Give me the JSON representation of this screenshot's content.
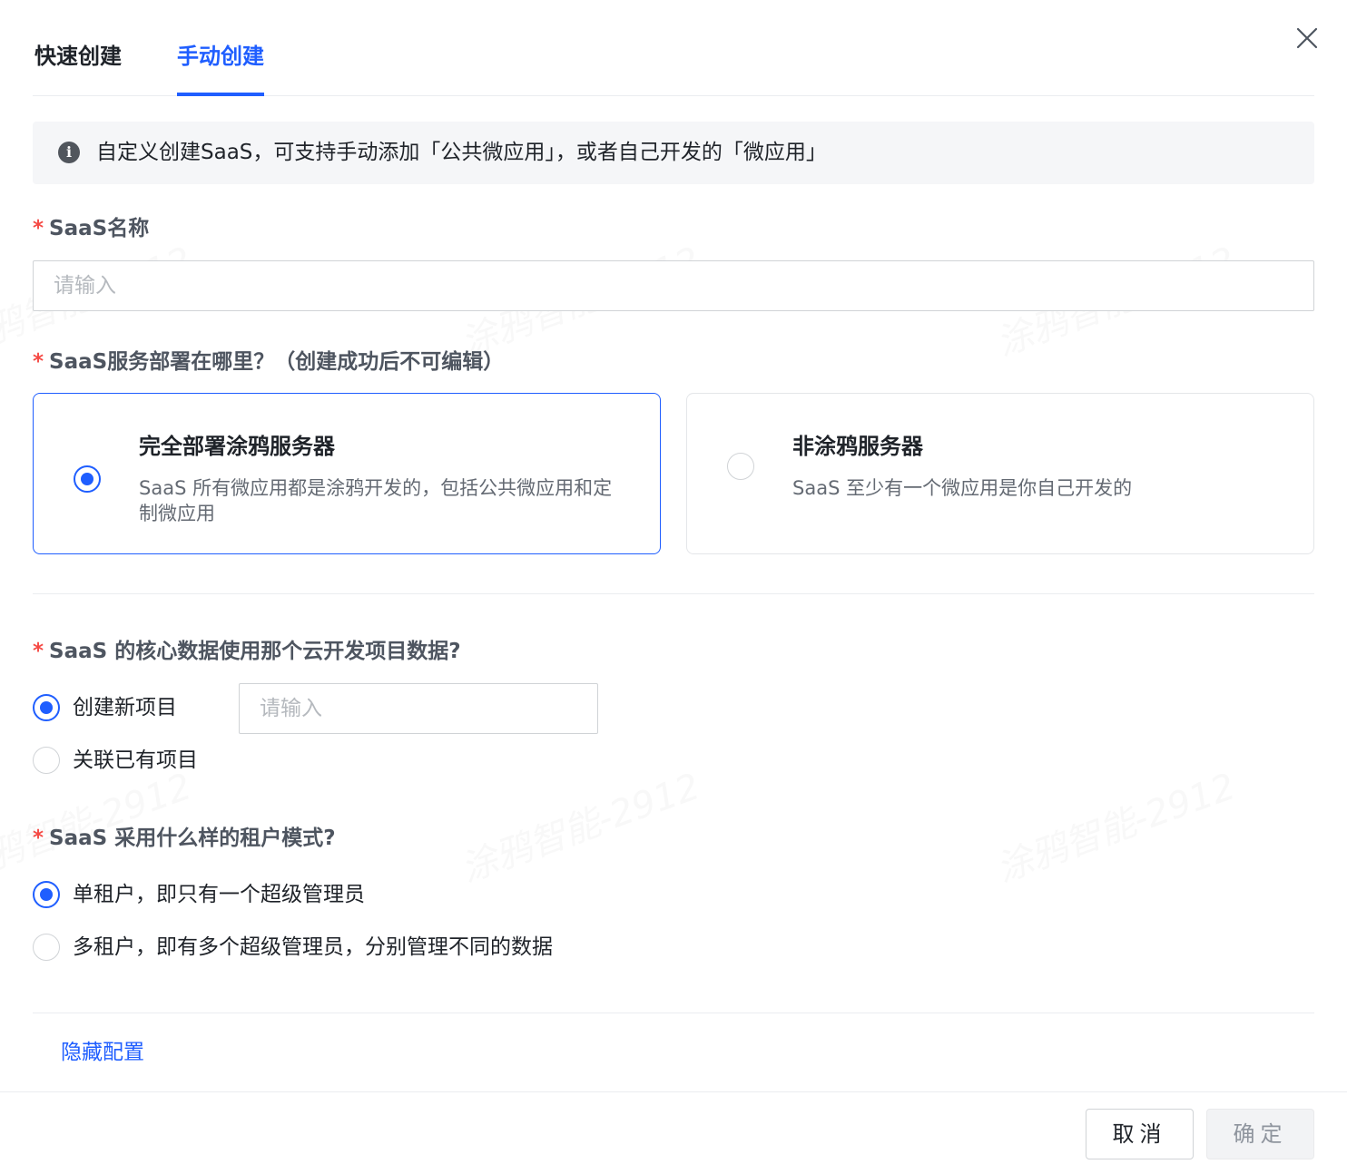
{
  "tabs": [
    {
      "label": "快速创建",
      "active": false
    },
    {
      "label": "手动创建",
      "active": true
    }
  ],
  "info": {
    "text": "自定义创建SaaS，可支持手动添加「公共微应用」，或者自己开发的「微应用」"
  },
  "name_field": {
    "label": "SaaS名称",
    "placeholder": "请输入",
    "value": ""
  },
  "deploy": {
    "label": "SaaS服务部署在哪里？（创建成功后不可编辑）",
    "options": [
      {
        "title": "完全部署涂鸦服务器",
        "desc": "SaaS 所有微应用都是涂鸦开发的，包括公共微应用和定制微应用",
        "selected": true
      },
      {
        "title": "非涂鸦服务器",
        "desc": "SaaS 至少有一个微应用是你自己开发的",
        "selected": false
      }
    ]
  },
  "core_data": {
    "label": "SaaS 的核心数据使用那个云开发项目数据?",
    "options": [
      {
        "label": "创建新项目",
        "selected": true
      },
      {
        "label": "关联已有项目",
        "selected": false
      }
    ],
    "project_input_placeholder": "请输入"
  },
  "tenant_mode": {
    "label": "SaaS 采用什么样的租户模式?",
    "options": [
      {
        "label": "单租户，即只有一个超级管理员",
        "selected": true
      },
      {
        "label": "多租户，即有多个超级管理员，分别管理不同的数据",
        "selected": false
      }
    ]
  },
  "hide_config_label": "隐藏配置",
  "footer": {
    "cancel_label": "取消",
    "ok_label": "确定"
  },
  "watermark": "涂鸦智能-2912",
  "colors": {
    "primary": "#1f5eff",
    "required": "#f54a45",
    "text": "#1f2329",
    "muted": "#646a73"
  },
  "icons": [
    "close-icon",
    "info-icon"
  ]
}
